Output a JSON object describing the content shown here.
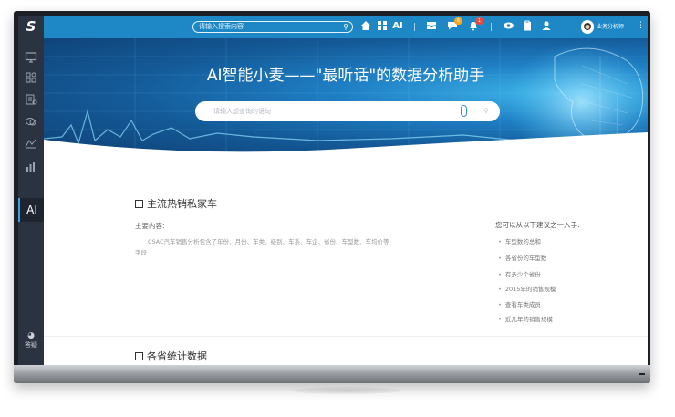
{
  "app": {
    "logo": "S"
  },
  "sidebar": {
    "icons": [
      "monitor-icon",
      "apps-icon",
      "database-icon",
      "layers-icon",
      "chart-area-icon",
      "bar-chart-icon"
    ],
    "active_label": "AI",
    "bottom_label": "答疑"
  },
  "topbar": {
    "search_placeholder": "请输入搜索内容",
    "ai_label": "AI",
    "badges": {
      "message": "6",
      "bell": "1"
    },
    "badge_colors": {
      "message": "#f5a623",
      "bell": "#e94b3c"
    },
    "user_name": "业务分析师"
  },
  "hero": {
    "title": "AI智能小麦——\"最听话\"的数据分析助手",
    "search_placeholder": "请输入想查询的语句"
  },
  "section1": {
    "title": "主流热销私家车",
    "main_label": "主要内容:",
    "description": "CSAC汽车销售分析包含了年份、月份、车类、级别、车系、车企、省份、车型数、车均价等字段",
    "suggest_title": "您可以从以下建议之一入手:",
    "suggestions": [
      "车型数的总和",
      "各省份的车型数",
      "有多少个省份",
      "2015年的销售规模",
      "查看车类成员",
      "近几年的销售规模"
    ]
  },
  "section2": {
    "title": "各省统计数据"
  },
  "colors": {
    "topbar": "#1e88c7",
    "sidebar": "#2c3340",
    "accent": "#3aa0e0"
  }
}
